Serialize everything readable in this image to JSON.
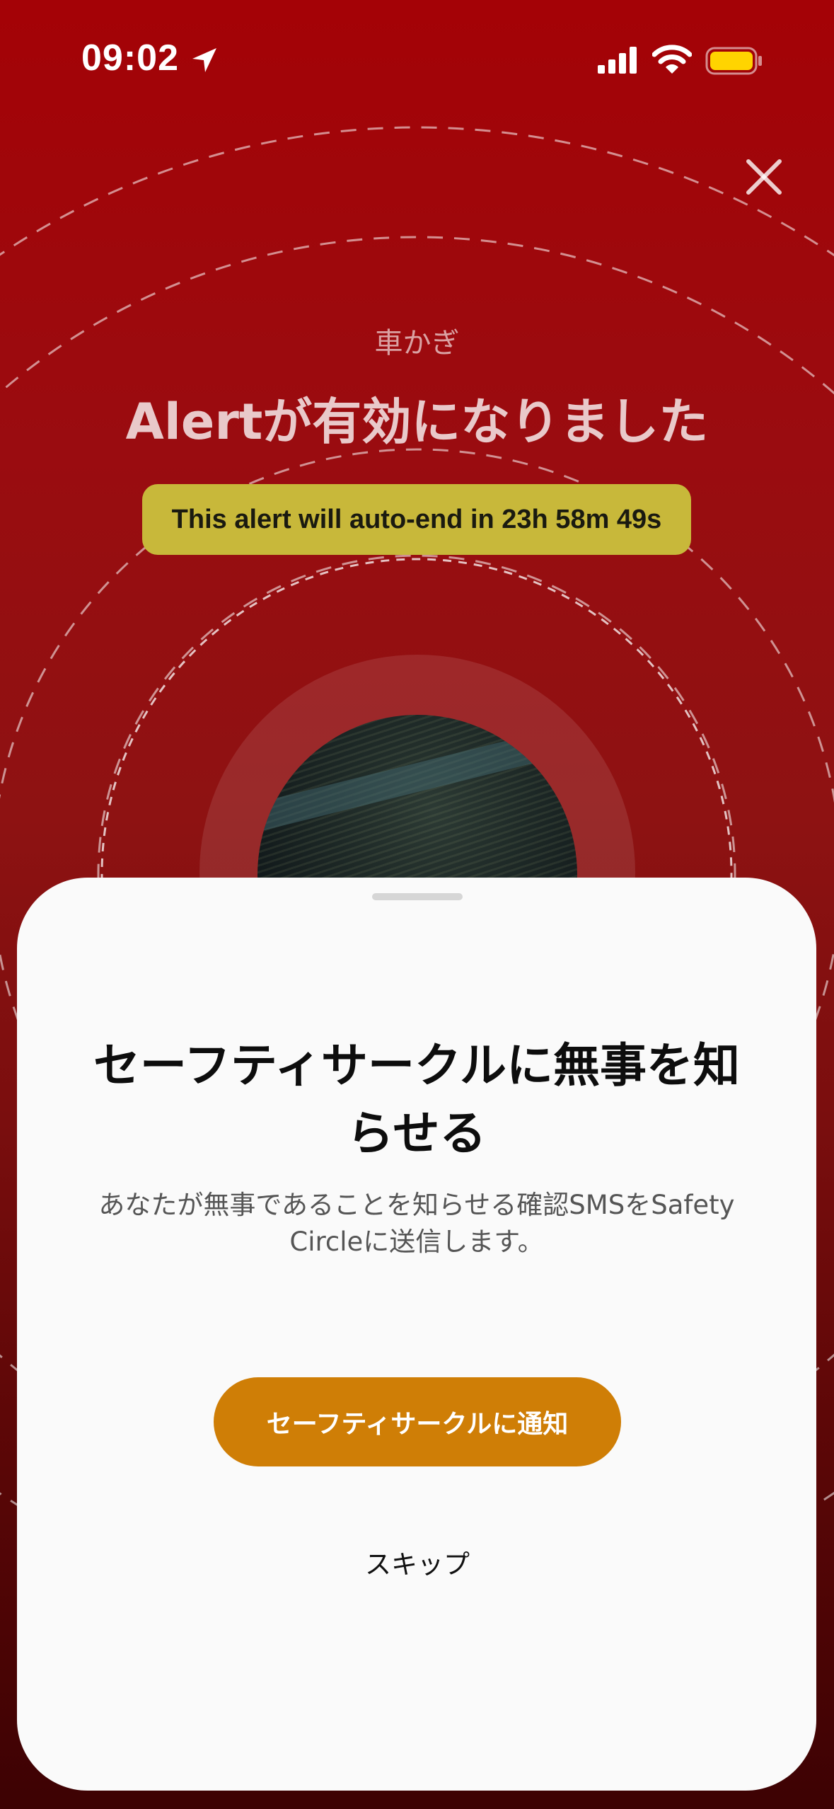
{
  "status_bar": {
    "time": "09:02",
    "icons": [
      "location-arrow-icon",
      "cellular-signal-icon",
      "wifi-icon",
      "battery-icon"
    ],
    "battery_color": "#ffd400"
  },
  "header": {
    "close_icon": "close-icon",
    "subtitle": "車かぎ",
    "title": "Alertが有効になりました",
    "auto_end": "This alert will auto-end in 23h 58m 49s"
  },
  "sheet": {
    "title": "セーフティサークルに無事を知らせる",
    "description": "あなたが無事であることを知らせる確認SMSをSafety Circleに送信します。",
    "notify_button": "セーフティサークルに通知",
    "skip_link": "スキップ"
  },
  "colors": {
    "background_top": "#a40206",
    "background_bottom": "#3d0203",
    "badge": "#c8b83a",
    "primary_button": "#cf7e06",
    "sheet": "#fafafa"
  }
}
